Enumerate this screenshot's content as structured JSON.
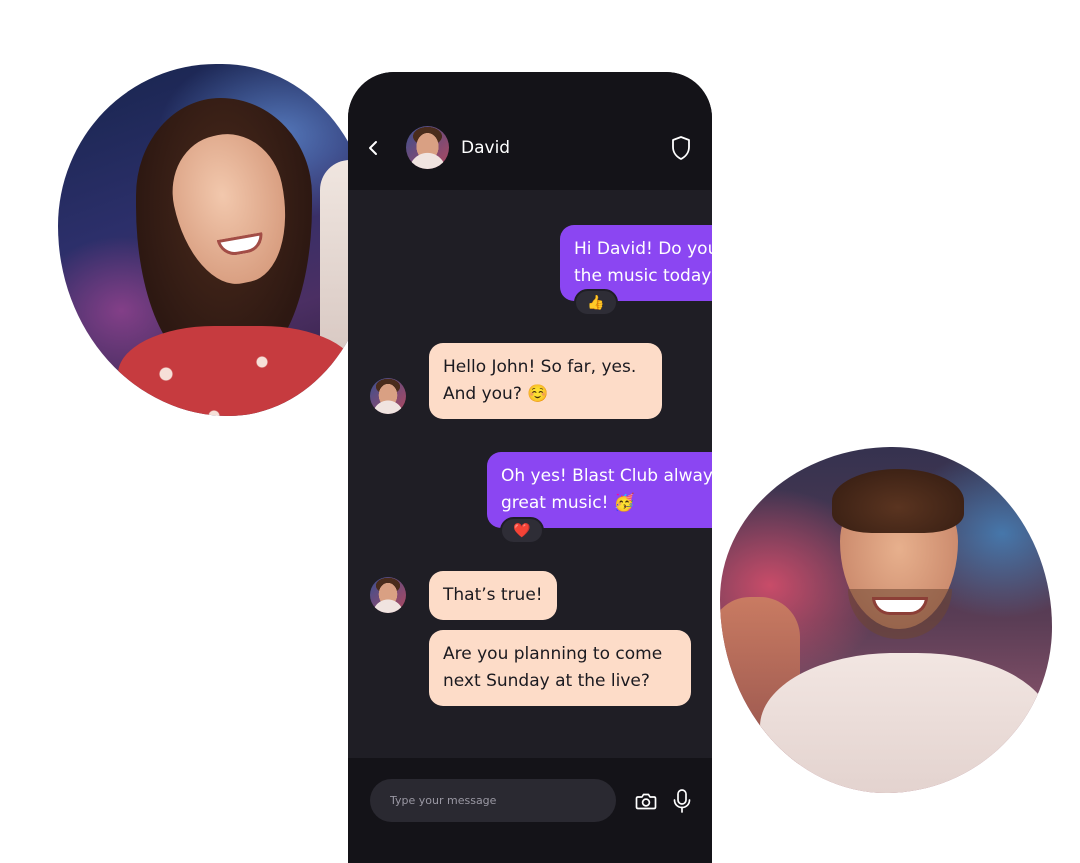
{
  "header": {
    "contact_name": "David"
  },
  "messages": [
    {
      "direction": "out",
      "text": "Hi David! Do you enjoy\nthe music today?",
      "reaction": "👍"
    },
    {
      "direction": "in",
      "text": "Hello John! So far, yes.\nAnd you?  ☺️"
    },
    {
      "direction": "out",
      "text": "Oh yes! Blast Club always plays\ngreat music!  🥳",
      "reaction": "❤️"
    },
    {
      "direction": "in",
      "text": "That’s true!"
    },
    {
      "direction": "in",
      "text": "Are you planning to come\nnext Sunday at the live?"
    }
  ],
  "composer": {
    "placeholder": "Type your message"
  },
  "icons": {
    "back": "chevron-left-icon",
    "shield": "shield-icon",
    "camera": "camera-icon",
    "mic": "microphone-icon"
  },
  "colors": {
    "outgoing_bubble": "#8b46f2",
    "incoming_bubble": "#fddcc8",
    "phone_background": "#1f1e25",
    "header_background": "#141318"
  }
}
